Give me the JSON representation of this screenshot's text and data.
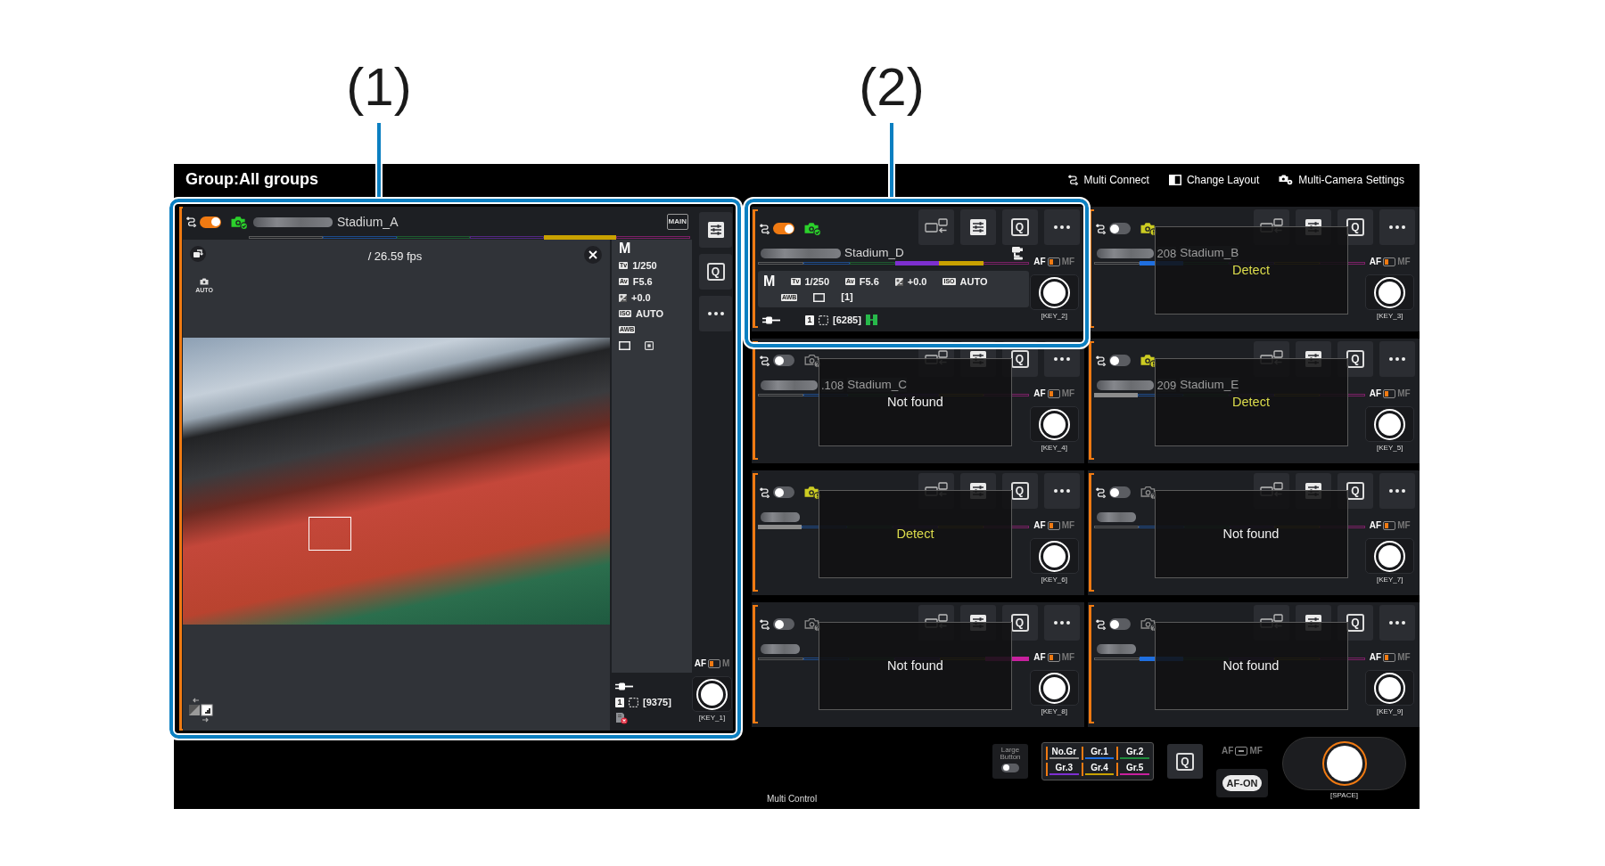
{
  "callouts": [
    {
      "label": "(1)"
    },
    {
      "label": "(2)"
    }
  ],
  "window": {
    "title": "Group:All groups",
    "actions": [
      {
        "kind": "connect",
        "label": "Multi Connect"
      },
      {
        "kind": "layout",
        "label": "Change Layout"
      },
      {
        "kind": "settings",
        "label": "Multi-Camera Settings"
      }
    ]
  },
  "main_camera": {
    "on": true,
    "kind": "connected",
    "name": "Stadium_A",
    "main_badge": "MAIN",
    "group_bar": [
      {
        "on": false
      },
      {
        "on": false
      },
      {
        "on": false
      },
      {
        "on": false
      },
      {
        "on": true
      },
      {
        "on": false
      }
    ],
    "fps": "/ 26.59 fps",
    "auto_label": "AUTO",
    "settings_rows": [
      [
        {
          "kind": "mode",
          "value": "M"
        }
      ],
      [
        {
          "kind": "tag",
          "tag": "Tv",
          "value": "1/250"
        }
      ],
      [
        {
          "kind": "tag",
          "tag": "Av",
          "value": "F5.6"
        }
      ],
      [
        {
          "kind": "exposure",
          "value": "+0.0"
        }
      ],
      [
        {
          "kind": "tag",
          "tag": "ISO",
          "value": "AUTO"
        }
      ],
      [
        {
          "kind": "tag",
          "tag": "AWB"
        }
      ],
      [
        {
          "kind": "drive"
        },
        {
          "kind": "focus"
        }
      ]
    ],
    "status_rows": [
      [
        {
          "kind": "plug"
        }
      ],
      [
        {
          "kind": "card",
          "value": "1"
        },
        {
          "kind": "dashed"
        },
        {
          "kind": "text",
          "value": "[9375]"
        }
      ],
      [
        {
          "kind": "card_error"
        }
      ]
    ],
    "quick_label": "Q",
    "af_mf": {
      "af": "AF",
      "mf": "M",
      "af_selected": true,
      "mf_selected": false
    },
    "key": "[KEY_1]"
  },
  "cameras": [
    {
      "on": true,
      "kind": "connected",
      "name": "Stadium_D",
      "mount": true,
      "group_bar": [
        {
          "on": false
        },
        {
          "on": false
        },
        {
          "on": false
        },
        {
          "on": true
        },
        {
          "on": true
        },
        {
          "on": false
        }
      ],
      "settings_rows": [
        [
          {
            "kind": "mode",
            "value": "M"
          },
          {
            "kind": "tag",
            "tag": "Tv",
            "value": "1/250"
          },
          {
            "kind": "tag",
            "tag": "Av",
            "value": "F5.6"
          },
          {
            "kind": "exposure",
            "value": "+0.0"
          },
          {
            "kind": "tag",
            "tag": "ISO",
            "value": "AUTO"
          }
        ],
        [
          {
            "kind": "tag",
            "tag": "AWB"
          },
          {
            "kind": "drive"
          },
          {
            "kind": "text",
            "value": "[1]"
          }
        ]
      ],
      "status_rows": [
        [
          {
            "kind": "plug"
          },
          {
            "kind": "card",
            "value": "1"
          },
          {
            "kind": "dashed"
          },
          {
            "kind": "text",
            "value": "[6285]"
          },
          {
            "kind": "battery"
          }
        ]
      ],
      "quick_label": "Q",
      "af_mf": {
        "af": "AF",
        "mf": "MF",
        "af_selected": true,
        "mf_selected": false
      },
      "key": "[KEY_2]"
    },
    {
      "on": false,
      "kind": "detect",
      "address_tail": "208",
      "name": "Stadium_B",
      "group_bar": [
        {
          "on": false
        },
        {
          "on": true
        },
        {
          "on": false
        },
        {
          "on": false
        },
        {
          "on": false
        },
        {
          "on": false
        }
      ],
      "overlay": "Detect",
      "quick_label": "Q",
      "af_mf": {
        "af": "AF",
        "mf": "MF",
        "af_selected": true,
        "mf_selected": false
      },
      "key": "[KEY_3]"
    },
    {
      "on": false,
      "kind": "not_found",
      "address_tail": ".108",
      "name": "Stadium_C",
      "group_bar": [
        {
          "on": false
        },
        {
          "on": false
        },
        {
          "on": false
        },
        {
          "on": false
        },
        {
          "on": false
        },
        {
          "on": false
        }
      ],
      "overlay": "Not found",
      "quick_label": "Q",
      "af_mf": {
        "af": "AF",
        "mf": "MF",
        "af_selected": true,
        "mf_selected": false
      },
      "key": "[KEY_4]"
    },
    {
      "on": false,
      "kind": "detect",
      "address_tail": "209",
      "name": "Stadium_E",
      "group_bar": [
        {
          "on": true
        },
        {
          "on": false
        },
        {
          "on": false
        },
        {
          "on": false
        },
        {
          "on": false
        },
        {
          "on": false
        }
      ],
      "overlay": "Detect",
      "quick_label": "Q",
      "af_mf": {
        "af": "AF",
        "mf": "MF",
        "af_selected": true,
        "mf_selected": false
      },
      "key": "[KEY_5]"
    },
    {
      "on": false,
      "kind": "detect",
      "group_bar": [
        {
          "on": true
        },
        {
          "on": false
        },
        {
          "on": false
        },
        {
          "on": false
        },
        {
          "on": false
        },
        {
          "on": false
        }
      ],
      "overlay": "Detect",
      "quick_label": "Q",
      "af_mf": {
        "af": "AF",
        "mf": "MF",
        "af_selected": true,
        "mf_selected": false
      },
      "key": "[KEY_6]"
    },
    {
      "on": false,
      "kind": "not_found",
      "group_bar": [
        {
          "on": false
        },
        {
          "on": false
        },
        {
          "on": false
        },
        {
          "on": false
        },
        {
          "on": false
        },
        {
          "on": false
        }
      ],
      "overlay": "Not found",
      "quick_label": "Q",
      "af_mf": {
        "af": "AF",
        "mf": "MF",
        "af_selected": true,
        "mf_selected": false
      },
      "key": "[KEY_7]"
    },
    {
      "on": false,
      "kind": "not_found",
      "group_bar": [
        {
          "on": false
        },
        {
          "on": false
        },
        {
          "on": false
        },
        {
          "on": false
        },
        {
          "on": false
        },
        {
          "on": true
        }
      ],
      "overlay": "Not found",
      "quick_label": "Q",
      "af_mf": {
        "af": "AF",
        "mf": "MF",
        "af_selected": true,
        "mf_selected": false
      },
      "key": "[KEY_8]"
    },
    {
      "on": false,
      "kind": "not_found",
      "group_bar": [
        {
          "on": false
        },
        {
          "on": true
        },
        {
          "on": false
        },
        {
          "on": false
        },
        {
          "on": false
        },
        {
          "on": false
        }
      ],
      "overlay": "Not found",
      "quick_label": "Q",
      "af_mf": {
        "af": "AF",
        "mf": "MF",
        "af_selected": true,
        "mf_selected": false
      },
      "key": "[KEY_9]"
    }
  ],
  "bottom_bar": {
    "caption": "Multi Control",
    "large_button": {
      "label": "Large Button",
      "on": false
    },
    "groups": [
      {
        "label": "No.Gr",
        "color": "#8c8c8c",
        "selected": true
      },
      {
        "label": "Gr.1",
        "color": "#1f6fe0",
        "selected": true
      },
      {
        "label": "Gr.2",
        "color": "#1f8a3c",
        "selected": true
      },
      {
        "label": "Gr.3",
        "color": "#7d2fd0",
        "selected": true
      },
      {
        "label": "Gr.4",
        "color": "#c9a100",
        "selected": true
      },
      {
        "label": "Gr.5",
        "color": "#c8209e",
        "selected": true
      }
    ],
    "quick_label": "Q",
    "af_mf": {
      "af": "AF",
      "mf": "MF",
      "af_selected": false,
      "mf_selected": false
    },
    "af_on": "AF-ON",
    "key": "[SPACE]"
  }
}
